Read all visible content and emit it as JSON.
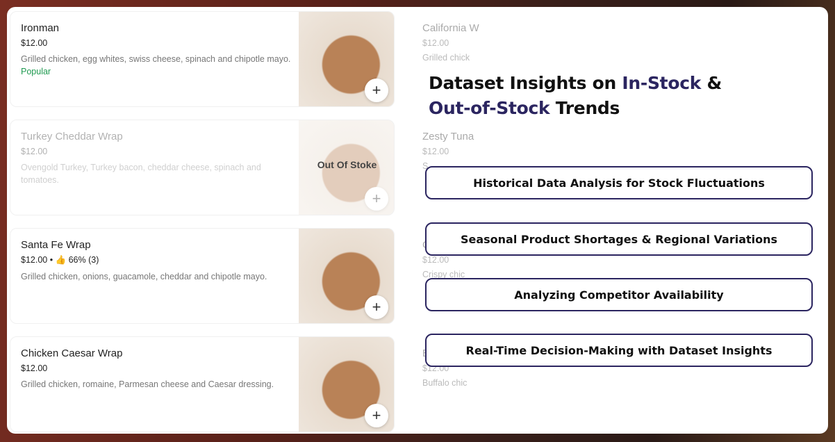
{
  "menu_items": [
    {
      "name": "Ironman",
      "price": "$12.00",
      "description": "Grilled chicken, egg whites, swiss cheese, spinach and chipotle mayo.",
      "tag": "Popular",
      "add": "+"
    },
    {
      "name": "Turkey Cheddar Wrap",
      "price": "$12.00",
      "description": "Ovengold Turkey, Turkey bacon, cheddar cheese, spinach and tomatoes.",
      "overlay": "Out Of Stoke",
      "add": "+"
    },
    {
      "name": "Santa Fe Wrap",
      "price": "$12.00 • 👍 66% (3)",
      "description": "Grilled chicken, onions, guacamole, cheddar and chipotle mayo.",
      "add": "+"
    },
    {
      "name": "Chicken Caesar Wrap",
      "price": "$12.00",
      "description": "Grilled chicken, romaine, Parmesan cheese and Caesar dressing.",
      "add": "+"
    }
  ],
  "right_items": [
    {
      "name": "California W",
      "price": "$12.00",
      "description": "Grilled chick"
    },
    {
      "name": "Zesty Tuna",
      "price": "$12.00",
      "description": "S"
    },
    {
      "name": "C",
      "price": "$12.00",
      "description": "Crispy chic"
    },
    {
      "name": "B",
      "price": "$12.00",
      "description": "Buffalo chic"
    }
  ],
  "heading": {
    "part1": "Dataset Insights on ",
    "hl1": "In-Stock",
    "part2": " & ",
    "hl2": "Out-of-Stock",
    "part3": " Trends"
  },
  "insights": [
    "Historical Data Analysis for Stock Fluctuations",
    "Seasonal Product Shortages & Regional Variations",
    "Analyzing Competitor Availability",
    "Real-Time Decision-Making with Dataset Insights"
  ],
  "colors": {
    "accent": "#2b2560",
    "popular": "#1f9a50"
  }
}
